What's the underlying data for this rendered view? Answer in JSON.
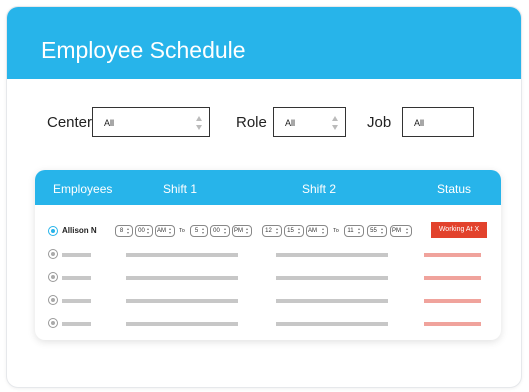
{
  "header": {
    "title": "Employee Schedule"
  },
  "filters": {
    "center": {
      "label": "Center",
      "value": "All"
    },
    "role": {
      "label": "Role",
      "value": "All"
    },
    "job": {
      "label": "Job",
      "value": "All"
    }
  },
  "table": {
    "columns": [
      "Employees",
      "Shift 1",
      "Shift 2",
      "Status"
    ],
    "selected_row": {
      "name": "Allison N",
      "shift1": {
        "start_hour": "8",
        "start_min": "00",
        "start_ampm": "AM",
        "to": "To",
        "end_hour": "5",
        "end_min": "00",
        "end_ampm": "PM"
      },
      "shift2": {
        "start_hour": "12",
        "start_min": "15",
        "start_ampm": "AM",
        "to": "To",
        "end_hour": "11",
        "end_min": "55",
        "end_ampm": "PM"
      },
      "status": "Working At X"
    },
    "placeholder_rows": 4
  },
  "colors": {
    "accent": "#27b4ea",
    "status_red": "#e2422c",
    "placeholder_gray": "#c7c7c7",
    "placeholder_red": "#f0a39c"
  }
}
